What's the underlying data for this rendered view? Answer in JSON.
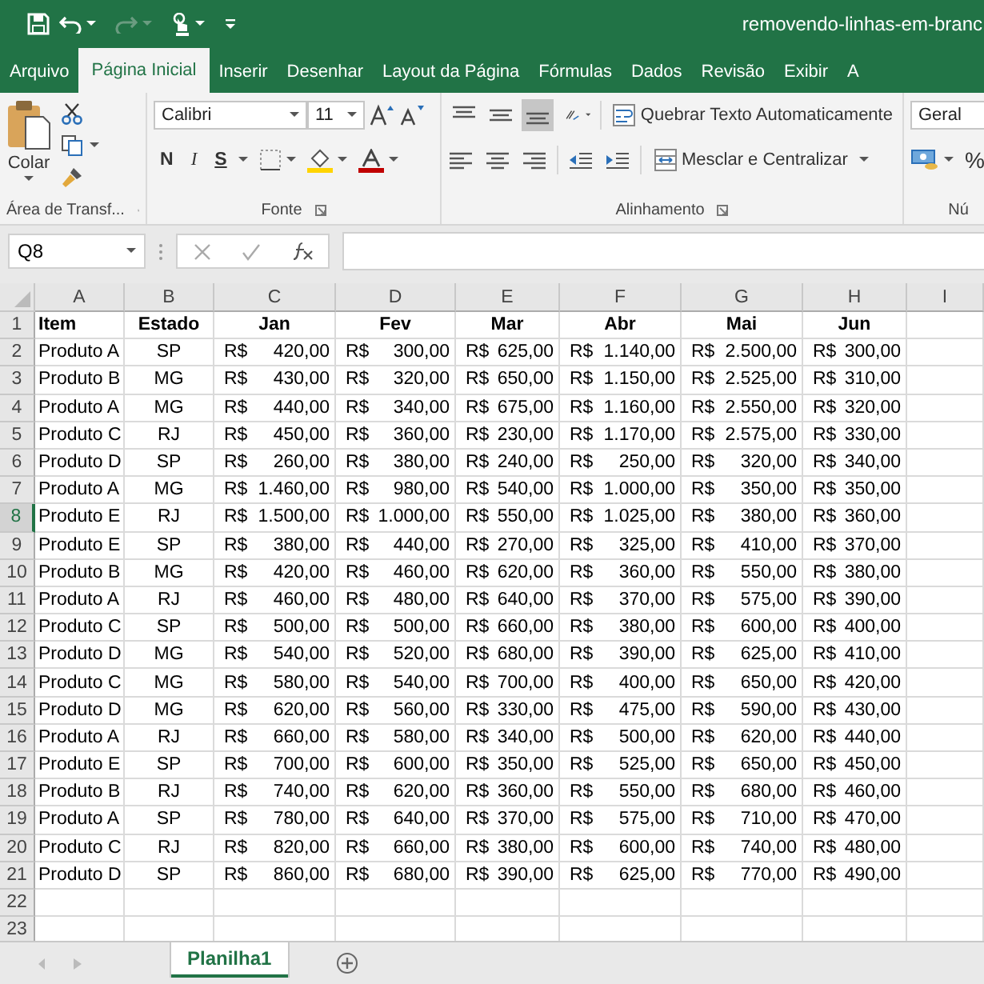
{
  "title_bar": {
    "title": "removendo-linhas-em-branc"
  },
  "menu_tabs": [
    {
      "label": "Arquivo",
      "selected": false
    },
    {
      "label": "Página Inicial",
      "selected": true
    },
    {
      "label": "Inserir",
      "selected": false
    },
    {
      "label": "Desenhar",
      "selected": false
    },
    {
      "label": "Layout da Página",
      "selected": false
    },
    {
      "label": "Fórmulas",
      "selected": false
    },
    {
      "label": "Dados",
      "selected": false
    },
    {
      "label": "Revisão",
      "selected": false
    },
    {
      "label": "Exibir",
      "selected": false
    },
    {
      "label": "A",
      "selected": false
    }
  ],
  "ribbon": {
    "paste": "Colar",
    "clipboard_label": "Área de Transf...",
    "font_name": "Calibri",
    "font_size": "11",
    "bold": "N",
    "italic": "I",
    "underline": "S",
    "font_label": "Fonte",
    "vertical_align": [
      {
        "selected": false
      },
      {
        "selected": false
      },
      {
        "selected": true
      }
    ],
    "wrap_text": "Quebrar Texto Automaticamente",
    "merge": "Mesclar e Centralizar",
    "alignment_label": "Alinhamento",
    "number_format": "Geral",
    "percent": "%",
    "number_label": "Nú"
  },
  "formula_bar": {
    "name_box": "Q8"
  },
  "columns": [
    "A",
    "B",
    "C",
    "D",
    "E",
    "F",
    "G",
    "H",
    "I"
  ],
  "rows": [
    {
      "number": "1",
      "selected": false,
      "kind": "header",
      "cells": [
        "Item",
        "Estado",
        "Jan",
        "Fev",
        "Mar",
        "Abr",
        "Mai",
        "Jun"
      ]
    },
    {
      "number": "2",
      "selected": false,
      "kind": "data",
      "cells": [
        "Produto A",
        "SP",
        "R$ 420,00",
        "R$ 300,00",
        "R$ 625,00",
        "R$ 1.140,00",
        "R$ 2.500,00",
        "R$ 300,00"
      ]
    },
    {
      "number": "3",
      "selected": false,
      "kind": "data",
      "cells": [
        "Produto B",
        "MG",
        "R$ 430,00",
        "R$ 320,00",
        "R$ 650,00",
        "R$ 1.150,00",
        "R$ 2.525,00",
        "R$ 310,00"
      ]
    },
    {
      "number": "4",
      "selected": false,
      "kind": "data",
      "cells": [
        "Produto A",
        "MG",
        "R$ 440,00",
        "R$ 340,00",
        "R$ 675,00",
        "R$ 1.160,00",
        "R$ 2.550,00",
        "R$ 320,00"
      ]
    },
    {
      "number": "5",
      "selected": false,
      "kind": "data",
      "cells": [
        "Produto C",
        "RJ",
        "R$ 450,00",
        "R$ 360,00",
        "R$ 230,00",
        "R$ 1.170,00",
        "R$ 2.575,00",
        "R$ 330,00"
      ]
    },
    {
      "number": "6",
      "selected": false,
      "kind": "data",
      "cells": [
        "Produto D",
        "SP",
        "R$ 260,00",
        "R$ 380,00",
        "R$ 240,00",
        "R$ 250,00",
        "R$ 320,00",
        "R$ 340,00"
      ]
    },
    {
      "number": "7",
      "selected": false,
      "kind": "data",
      "cells": [
        "Produto A",
        "MG",
        "R$ 1.460,00",
        "R$ 980,00",
        "R$ 540,00",
        "R$ 1.000,00",
        "R$ 350,00",
        "R$ 350,00"
      ]
    },
    {
      "number": "8",
      "selected": true,
      "kind": "data",
      "cells": [
        "Produto E",
        "RJ",
        "R$ 1.500,00",
        "R$ 1.000,00",
        "R$ 550,00",
        "R$ 1.025,00",
        "R$ 380,00",
        "R$ 360,00"
      ]
    },
    {
      "number": "9",
      "selected": false,
      "kind": "data",
      "cells": [
        "Produto E",
        "SP",
        "R$ 380,00",
        "R$ 440,00",
        "R$ 270,00",
        "R$ 325,00",
        "R$ 410,00",
        "R$ 370,00"
      ]
    },
    {
      "number": "10",
      "selected": false,
      "kind": "data",
      "cells": [
        "Produto B",
        "MG",
        "R$ 420,00",
        "R$ 460,00",
        "R$ 620,00",
        "R$ 360,00",
        "R$ 550,00",
        "R$ 380,00"
      ]
    },
    {
      "number": "11",
      "selected": false,
      "kind": "data",
      "cells": [
        "Produto A",
        "RJ",
        "R$ 460,00",
        "R$ 480,00",
        "R$ 640,00",
        "R$ 370,00",
        "R$ 575,00",
        "R$ 390,00"
      ]
    },
    {
      "number": "12",
      "selected": false,
      "kind": "data",
      "cells": [
        "Produto C",
        "SP",
        "R$ 500,00",
        "R$ 500,00",
        "R$ 660,00",
        "R$ 380,00",
        "R$ 600,00",
        "R$ 400,00"
      ]
    },
    {
      "number": "13",
      "selected": false,
      "kind": "data",
      "cells": [
        "Produto D",
        "MG",
        "R$ 540,00",
        "R$ 520,00",
        "R$ 680,00",
        "R$ 390,00",
        "R$ 625,00",
        "R$ 410,00"
      ]
    },
    {
      "number": "14",
      "selected": false,
      "kind": "data",
      "cells": [
        "Produto C",
        "MG",
        "R$ 580,00",
        "R$ 540,00",
        "R$ 700,00",
        "R$ 400,00",
        "R$ 650,00",
        "R$ 420,00"
      ]
    },
    {
      "number": "15",
      "selected": false,
      "kind": "data",
      "cells": [
        "Produto D",
        "MG",
        "R$ 620,00",
        "R$ 560,00",
        "R$ 330,00",
        "R$ 475,00",
        "R$ 590,00",
        "R$ 430,00"
      ]
    },
    {
      "number": "16",
      "selected": false,
      "kind": "data",
      "cells": [
        "Produto A",
        "RJ",
        "R$ 660,00",
        "R$ 580,00",
        "R$ 340,00",
        "R$ 500,00",
        "R$ 620,00",
        "R$ 440,00"
      ]
    },
    {
      "number": "17",
      "selected": false,
      "kind": "data",
      "cells": [
        "Produto E",
        "SP",
        "R$ 700,00",
        "R$ 600,00",
        "R$ 350,00",
        "R$ 525,00",
        "R$ 650,00",
        "R$ 450,00"
      ]
    },
    {
      "number": "18",
      "selected": false,
      "kind": "data",
      "cells": [
        "Produto B",
        "RJ",
        "R$ 740,00",
        "R$ 620,00",
        "R$ 360,00",
        "R$ 550,00",
        "R$ 680,00",
        "R$ 460,00"
      ]
    },
    {
      "number": "19",
      "selected": false,
      "kind": "data",
      "cells": [
        "Produto A",
        "SP",
        "R$ 780,00",
        "R$ 640,00",
        "R$ 370,00",
        "R$ 575,00",
        "R$ 710,00",
        "R$ 470,00"
      ]
    },
    {
      "number": "20",
      "selected": false,
      "kind": "data",
      "cells": [
        "Produto C",
        "RJ",
        "R$ 820,00",
        "R$ 660,00",
        "R$ 380,00",
        "R$ 600,00",
        "R$ 740,00",
        "R$ 480,00"
      ]
    },
    {
      "number": "21",
      "selected": false,
      "kind": "data",
      "cells": [
        "Produto D",
        "SP",
        "R$ 860,00",
        "R$ 680,00",
        "R$ 390,00",
        "R$ 625,00",
        "R$ 770,00",
        "R$ 490,00"
      ]
    },
    {
      "number": "22",
      "selected": false,
      "cells": []
    },
    {
      "number": "23",
      "selected": false,
      "cells": []
    }
  ],
  "sheet_tabs": [
    {
      "label": "Planilha1",
      "selected": true
    }
  ]
}
